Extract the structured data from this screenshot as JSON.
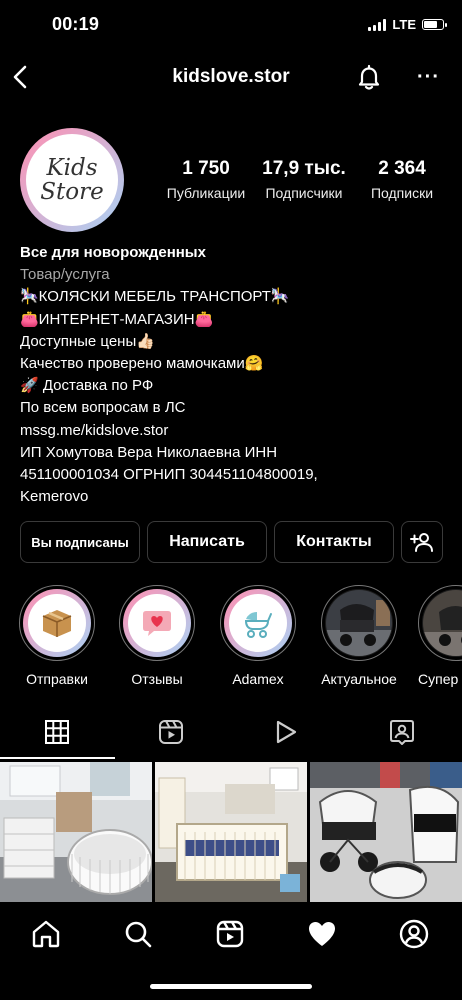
{
  "status_bar": {
    "time": "00:19",
    "network": "LTE",
    "battery_level": 0.8
  },
  "header": {
    "username": "kidslove.stor"
  },
  "avatar": {
    "line1": "Kids",
    "line2": "Store"
  },
  "stats": [
    {
      "value": "1 750",
      "label": "Публикации"
    },
    {
      "value": "17,9 тыс.",
      "label": "Подписчики"
    },
    {
      "value": "2 364",
      "label": "Подписки"
    }
  ],
  "bio": {
    "name": "Все для новорожденных",
    "category": "Товар/услуга",
    "lines": [
      "🎠КОЛЯСКИ МЕБЕЛЬ ТРАНСПОРТ🎠",
      "👛ИНТЕРНЕТ-МАГАЗИН👛",
      "Доступные цены👍🏻",
      "Качество проверено мамочками🤗",
      "🚀 Доставка по РФ",
      "По всем вопросам в ЛС",
      "mssg.me/kidslove.stor",
      "ИП Хомутова Вера Николаевна ИНН",
      "451100001034 ОГРНИП 304451104800019,",
      "Kemerovo"
    ]
  },
  "buttons": {
    "subscribed": "Вы подписаны",
    "message": "Написать",
    "contacts": "Контакты"
  },
  "highlights": [
    {
      "label": "Отправки",
      "icon": "box-icon"
    },
    {
      "label": "Отзывы",
      "icon": "heart-chat-icon"
    },
    {
      "label": "Adamex",
      "icon": "stroller-icon"
    },
    {
      "label": "Актуальное",
      "icon": "stroller-photo"
    },
    {
      "label": "Супер",
      "icon": "stroller-photo"
    }
  ],
  "tabs": [
    "grid-icon",
    "reels-icon",
    "play-icon",
    "tagged-icon"
  ],
  "nav": [
    "home-icon",
    "search-icon",
    "reels-icon",
    "heart-icon",
    "profile-icon"
  ],
  "colors": {
    "background": "#000000",
    "text": "#ffffff",
    "muted": "#a8a8a8",
    "brand_pink": "#ff8fb1",
    "brand_blue": "#a9d3f5"
  }
}
